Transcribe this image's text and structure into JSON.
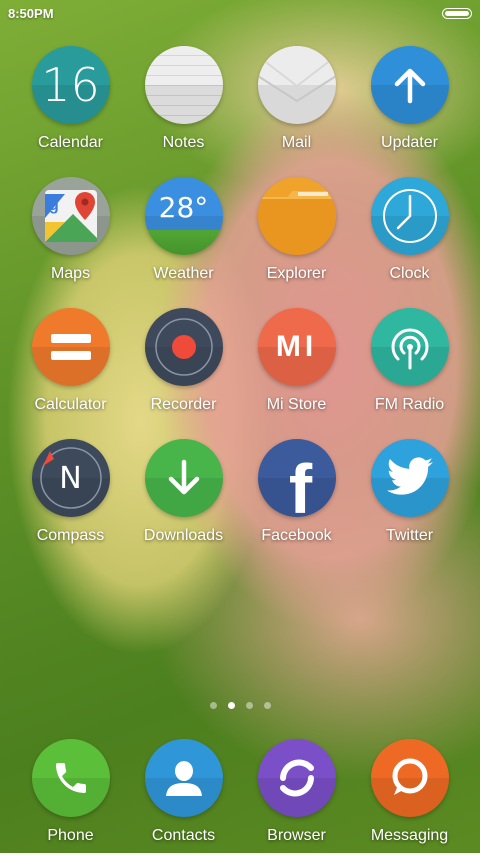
{
  "status_bar": {
    "time": "8:50PM"
  },
  "apps": [
    {
      "label": "Calendar",
      "icon": "calendar-icon",
      "color": "#2a9b9b",
      "text": "16"
    },
    {
      "label": "Notes",
      "icon": "notes-icon",
      "color": "#e6e6e6"
    },
    {
      "label": "Mail",
      "icon": "mail-icon",
      "color": "#e9e9e9"
    },
    {
      "label": "Updater",
      "icon": "updater-icon",
      "color": "#2f8fd8"
    },
    {
      "label": "Maps",
      "icon": "maps-icon",
      "color": "#8a9a8a"
    },
    {
      "label": "Weather",
      "icon": "weather-icon",
      "color": "#3b8fe0",
      "text": "28°"
    },
    {
      "label": "Explorer",
      "icon": "explorer-icon",
      "color": "#f0a32a"
    },
    {
      "label": "Clock",
      "icon": "clock-icon",
      "color": "#2ea8d8"
    },
    {
      "label": "Calculator",
      "icon": "calculator-icon",
      "color": "#f07a2c"
    },
    {
      "label": "Recorder",
      "icon": "recorder-icon",
      "color": "#3e4a5c"
    },
    {
      "label": "Mi Store",
      "icon": "mi-store-icon",
      "color": "#ef6a4a",
      "text": "MI"
    },
    {
      "label": "FM Radio",
      "icon": "fm-radio-icon",
      "color": "#2fb7a0"
    },
    {
      "label": "Compass",
      "icon": "compass-icon",
      "color": "#3d4a5c",
      "text": "N"
    },
    {
      "label": "Downloads",
      "icon": "downloads-icon",
      "color": "#47b54a"
    },
    {
      "label": "Facebook",
      "icon": "facebook-icon",
      "color": "#3b5b9d",
      "text": "f"
    },
    {
      "label": "Twitter",
      "icon": "twitter-icon",
      "color": "#2ea2dd"
    }
  ],
  "page_indicator": {
    "count": 4,
    "active": 1
  },
  "dock": [
    {
      "label": "Phone",
      "icon": "phone-icon",
      "color": "#5cbf3a"
    },
    {
      "label": "Contacts",
      "icon": "contacts-icon",
      "color": "#2f96d8"
    },
    {
      "label": "Browser",
      "icon": "browser-icon",
      "color": "#7b4fc8"
    },
    {
      "label": "Messaging",
      "icon": "messaging-icon",
      "color": "#ee6a24"
    }
  ]
}
